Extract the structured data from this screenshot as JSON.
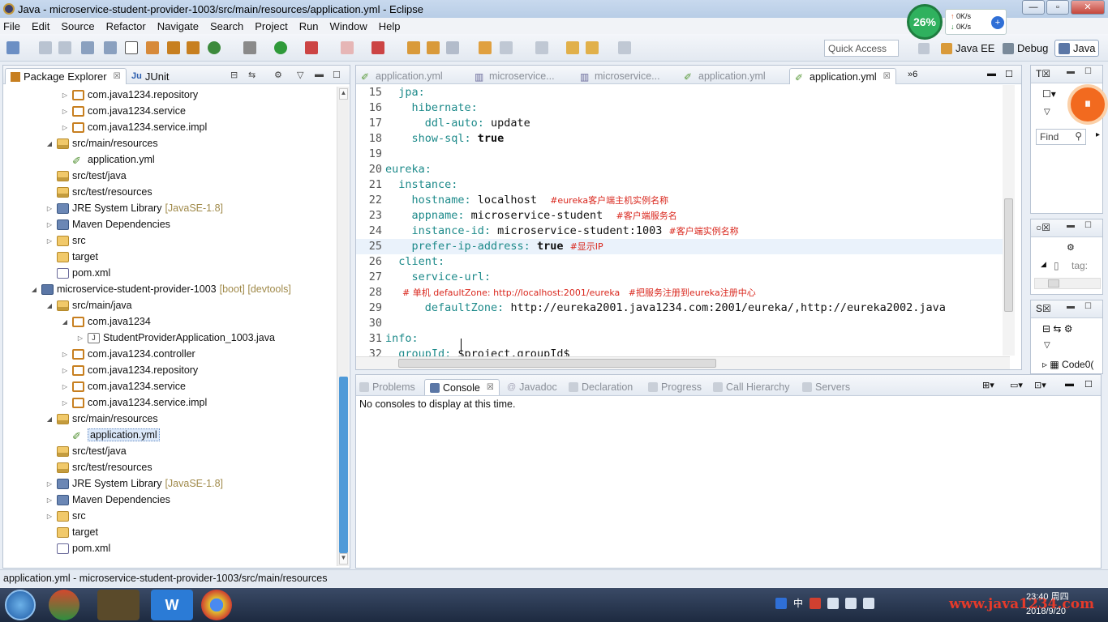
{
  "window": {
    "title": "Java - microservice-student-provider-1003/src/main/resources/application.yml - Eclipse"
  },
  "overlay": {
    "cpu": "26%",
    "up": "0K/s",
    "down": "0K/s"
  },
  "menu": [
    "File",
    "Edit",
    "Source",
    "Refactor",
    "Navigate",
    "Search",
    "Project",
    "Run",
    "Window",
    "Help"
  ],
  "toolbar": {
    "quick_access": "Quick Access",
    "perspectives": [
      "Java EE",
      "Debug",
      "Java"
    ]
  },
  "left": {
    "tabs": [
      "Package Explorer",
      "JUnit"
    ],
    "tree": [
      {
        "label": "com.java1234.repository",
        "icon": "package-icon",
        "arrow": "▷",
        "indent": 2
      },
      {
        "label": "com.java1234.service",
        "icon": "package-icon",
        "arrow": "▷",
        "indent": 2
      },
      {
        "label": "com.java1234.service.impl",
        "icon": "package-icon",
        "arrow": "▷",
        "indent": 2
      },
      {
        "label": "src/main/resources",
        "icon": "source-folder-icon",
        "arrow": "◢",
        "indent": 1
      },
      {
        "label": "application.yml",
        "icon": "yml-file-icon",
        "arrow": "",
        "indent": 2
      },
      {
        "label": "src/test/java",
        "icon": "source-folder-icon",
        "arrow": "",
        "indent": 1
      },
      {
        "label": "src/test/resources",
        "icon": "source-folder-icon",
        "arrow": "",
        "indent": 1
      },
      {
        "label": "JRE System Library",
        "deco": "[JavaSE-1.8]",
        "icon": "library-icon",
        "arrow": "▷",
        "indent": 1
      },
      {
        "label": "Maven Dependencies",
        "icon": "library-icon",
        "arrow": "▷",
        "indent": 1
      },
      {
        "label": "src",
        "icon": "folder-icon",
        "arrow": "▷",
        "indent": 1
      },
      {
        "label": "target",
        "icon": "folder-icon",
        "arrow": "",
        "indent": 1
      },
      {
        "label": "pom.xml",
        "icon": "xml-file-icon",
        "arrow": "",
        "indent": 1
      },
      {
        "label": "microservice-student-provider-1003",
        "deco": "[boot] [devtools]",
        "icon": "project-icon",
        "arrow": "◢",
        "indent": 0
      },
      {
        "label": "src/main/java",
        "icon": "source-folder-icon",
        "arrow": "◢",
        "indent": 1
      },
      {
        "label": "com.java1234",
        "icon": "package-icon",
        "arrow": "◢",
        "indent": 2
      },
      {
        "label": "StudentProviderApplication_1003.java",
        "icon": "java-file-icon",
        "arrow": "▷",
        "indent": 3
      },
      {
        "label": "com.java1234.controller",
        "icon": "package-icon",
        "arrow": "▷",
        "indent": 2
      },
      {
        "label": "com.java1234.repository",
        "icon": "package-icon",
        "arrow": "▷",
        "indent": 2
      },
      {
        "label": "com.java1234.service",
        "icon": "package-icon",
        "arrow": "▷",
        "indent": 2
      },
      {
        "label": "com.java1234.service.impl",
        "icon": "package-icon",
        "arrow": "▷",
        "indent": 2
      },
      {
        "label": "src/main/resources",
        "icon": "source-folder-icon",
        "arrow": "◢",
        "indent": 1
      },
      {
        "label": "application.yml",
        "icon": "yml-file-icon",
        "arrow": "",
        "indent": 2,
        "selected": true
      },
      {
        "label": "src/test/java",
        "icon": "source-folder-icon",
        "arrow": "",
        "indent": 1
      },
      {
        "label": "src/test/resources",
        "icon": "source-folder-icon",
        "arrow": "",
        "indent": 1
      },
      {
        "label": "JRE System Library",
        "deco": "[JavaSE-1.8]",
        "icon": "library-icon",
        "arrow": "▷",
        "indent": 1
      },
      {
        "label": "Maven Dependencies",
        "icon": "library-icon",
        "arrow": "▷",
        "indent": 1
      },
      {
        "label": "src",
        "icon": "folder-icon",
        "arrow": "▷",
        "indent": 1
      },
      {
        "label": "target",
        "icon": "folder-icon",
        "arrow": "",
        "indent": 1
      },
      {
        "label": "pom.xml",
        "icon": "xml-file-icon",
        "arrow": "",
        "indent": 1
      }
    ]
  },
  "editor": {
    "tabs": [
      {
        "label": "application.yml",
        "active": false
      },
      {
        "label": "microservice...",
        "active": false
      },
      {
        "label": "microservice...",
        "active": false
      },
      {
        "label": "application.yml",
        "active": false
      },
      {
        "label": "application.yml",
        "active": true
      }
    ],
    "overflow": "»6",
    "lines": [
      {
        "n": "15",
        "parts": [
          [
            "k",
            "  jpa:"
          ]
        ]
      },
      {
        "n": "16",
        "parts": [
          [
            "k",
            "    hibernate:"
          ]
        ]
      },
      {
        "n": "17",
        "parts": [
          [
            "k",
            "      ddl-auto: "
          ],
          [
            "v",
            "update"
          ]
        ]
      },
      {
        "n": "18",
        "parts": [
          [
            "k",
            "    show-sql: "
          ],
          [
            "b",
            "true"
          ]
        ]
      },
      {
        "n": "19",
        "parts": []
      },
      {
        "n": "20",
        "parts": [
          [
            "k",
            "eureka:"
          ]
        ]
      },
      {
        "n": "21",
        "parts": [
          [
            "k",
            "  instance:"
          ]
        ]
      },
      {
        "n": "22",
        "parts": [
          [
            "k",
            "    hostname: "
          ],
          [
            "v",
            "localhost  "
          ],
          [
            "c",
            "#eureka客户端主机实例名称"
          ]
        ]
      },
      {
        "n": "23",
        "parts": [
          [
            "k",
            "    appname: "
          ],
          [
            "v",
            "microservice-student  "
          ],
          [
            "c",
            "#客户端服务名"
          ]
        ]
      },
      {
        "n": "24",
        "parts": [
          [
            "k",
            "    instance-id: "
          ],
          [
            "v",
            "microservice-student:1003 "
          ],
          [
            "c",
            "#客户端实例名称"
          ]
        ]
      },
      {
        "n": "25",
        "parts": [
          [
            "k",
            "    prefer-ip-address: "
          ],
          [
            "b",
            "true "
          ],
          [
            "c",
            "#显示IP"
          ]
        ],
        "hl": true
      },
      {
        "n": "26",
        "parts": [
          [
            "k",
            "  client:"
          ]
        ]
      },
      {
        "n": "27",
        "parts": [
          [
            "k",
            "    service-url:"
          ]
        ]
      },
      {
        "n": "28",
        "parts": [
          [
            "c",
            "      # 单机 defaultZone: http://localhost:2001/eureka   #把服务注册到eureka注册中心"
          ]
        ]
      },
      {
        "n": "29",
        "parts": [
          [
            "k",
            "      defaultZone: "
          ],
          [
            "v",
            "http://eureka2001.java1234.com:2001/eureka/,http://eureka2002.java"
          ]
        ]
      },
      {
        "n": "30",
        "parts": []
      },
      {
        "n": "31",
        "parts": [
          [
            "k",
            "info:"
          ]
        ]
      },
      {
        "n": "32",
        "parts": [
          [
            "k",
            "  groupId: "
          ],
          [
            "v",
            "$project.groupId$"
          ]
        ]
      }
    ]
  },
  "console": {
    "tabs": [
      "Problems",
      "Console",
      "Javadoc",
      "Declaration",
      "Progress",
      "Call Hierarchy",
      "Servers"
    ],
    "active": "Console",
    "message": "No consoles to display at this time."
  },
  "right": {
    "find_placeholder": "Find",
    "tag_label": "tag:",
    "code_label": "Code0("
  },
  "status": {
    "text": "application.yml - microservice-student-provider-1003/src/main/resources"
  },
  "taskbar": {
    "tray_lang": "中",
    "watermark": "www.java1234.com",
    "time": "23:40 周四",
    "date": "2018/9/20"
  }
}
